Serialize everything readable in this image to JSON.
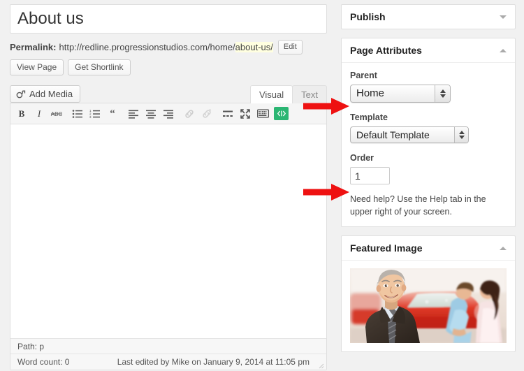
{
  "colors": {
    "page_background": "#f1f1f1",
    "panel": "#ffffff",
    "border": "#dfdfdf",
    "arrow_red": "#ee1111",
    "code_button_green": "#2bb673",
    "slug_highlight": "#ffffe0"
  },
  "editor": {
    "title_value": "About us",
    "title_placeholder": "Enter title here",
    "permalink": {
      "label": "Permalink:",
      "base_url": "http://redline.progressionstudios.com/home/",
      "slug": "about-us/",
      "edit_label": "Edit"
    },
    "actions": {
      "view_page_label": "View Page",
      "get_shortlink_label": "Get Shortlink"
    },
    "add_media_label": "Add Media",
    "tabs": [
      {
        "label": "Visual",
        "active": true
      },
      {
        "label": "Text",
        "active": false
      }
    ],
    "toolbar": [
      {
        "name": "bold-icon",
        "title": "Bold"
      },
      {
        "name": "italic-icon",
        "title": "Italic"
      },
      {
        "name": "strikethrough-icon",
        "title": "Strikethrough"
      },
      {
        "name": "bullet-list-icon",
        "title": "Unordered list"
      },
      {
        "name": "numbered-list-icon",
        "title": "Ordered list"
      },
      {
        "name": "blockquote-icon",
        "title": "Blockquote"
      },
      {
        "name": "align-left-icon",
        "title": "Align left"
      },
      {
        "name": "align-center-icon",
        "title": "Align center"
      },
      {
        "name": "align-right-icon",
        "title": "Align right"
      },
      {
        "name": "link-icon",
        "title": "Insert/edit link"
      },
      {
        "name": "unlink-icon",
        "title": "Remove link"
      },
      {
        "name": "insert-more-tag-icon",
        "title": "Insert More tag"
      },
      {
        "name": "fullscreen-icon",
        "title": "Distraction free writing mode"
      },
      {
        "name": "kitchen-sink-icon",
        "title": "Toggle toolbar"
      },
      {
        "name": "shortcode-icon",
        "title": "Insert shortcode"
      }
    ],
    "content_value": "",
    "status": {
      "path_label": "Path: p",
      "word_count_label": "Word count: 0",
      "last_edited_label": "Last edited by Mike on January 9, 2014 at 11:05 pm"
    }
  },
  "sidebar": {
    "publish": {
      "title": "Publish",
      "collapsed": true
    },
    "page_attributes": {
      "title": "Page Attributes",
      "collapsed": false,
      "parent": {
        "label": "Parent",
        "value": "Home"
      },
      "template": {
        "label": "Template",
        "value": "Default Template"
      },
      "order": {
        "label": "Order",
        "value": "1"
      },
      "help_text": "Need help? Use the Help tab in the upper right of your screen."
    },
    "featured_image": {
      "title": "Featured Image",
      "collapsed": false,
      "image_description": "Smiling car salesman in a dark suit standing in front of a red car, with a couple looking at the car in the background"
    }
  },
  "annotations": {
    "arrow_1_target": "Parent select",
    "arrow_2_target": "Order input"
  }
}
